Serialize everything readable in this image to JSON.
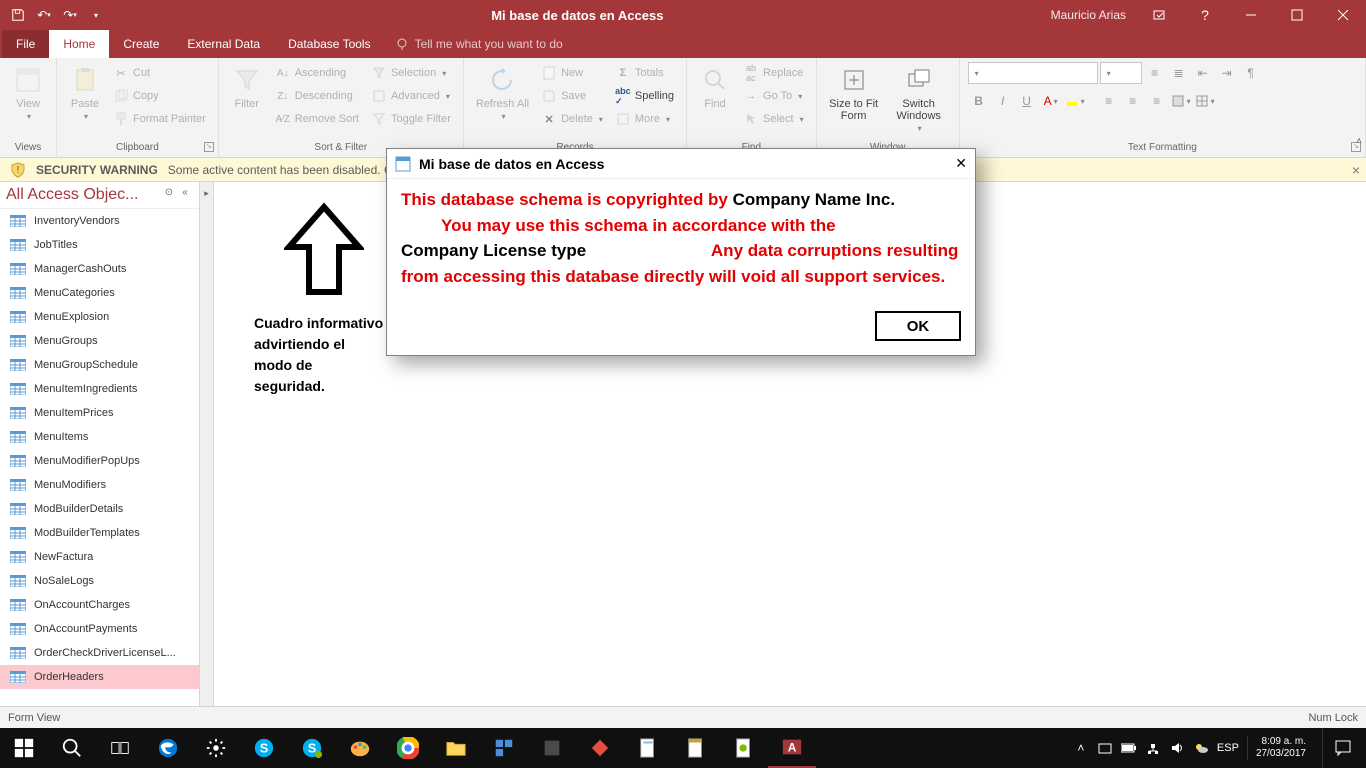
{
  "titlebar": {
    "title": "Mi base de datos en Access",
    "user": "Mauricio Arias"
  },
  "tabs": {
    "file": "File",
    "home": "Home",
    "create": "Create",
    "external": "External Data",
    "dbtools": "Database Tools",
    "tellme": "Tell me what you want to do"
  },
  "ribbon": {
    "views": {
      "label": "Views",
      "view": "View"
    },
    "clipboard": {
      "label": "Clipboard",
      "paste": "Paste",
      "cut": "Cut",
      "copy": "Copy",
      "fmtpainter": "Format Painter"
    },
    "sortfilter": {
      "label": "Sort & Filter",
      "filter": "Filter",
      "asc": "Ascending",
      "desc": "Descending",
      "remsort": "Remove Sort",
      "selection": "Selection",
      "advanced": "Advanced",
      "toggle": "Toggle Filter"
    },
    "records": {
      "label": "Records",
      "refresh": "Refresh All",
      "new": "New",
      "save": "Save",
      "delete": "Delete",
      "totals": "Totals",
      "spelling": "Spelling",
      "more": "More"
    },
    "find": {
      "label": "Find",
      "find": "Find",
      "replace": "Replace",
      "goto": "Go To",
      "select": "Select"
    },
    "window": {
      "label": "Window",
      "sizefit": "Size to Fit Form",
      "switch": "Switch Windows"
    },
    "textfmt": {
      "label": "Text Formatting"
    }
  },
  "security": {
    "warning": "SECURITY WARNING",
    "msg": "Some active content has been disabled. Cl"
  },
  "nav": {
    "title": "All Access Objec...",
    "items": [
      "InventoryVendors",
      "JobTitles",
      "ManagerCashOuts",
      "MenuCategories",
      "MenuExplosion",
      "MenuGroups",
      "MenuGroupSchedule",
      "MenuItemIngredients",
      "MenuItemPrices",
      "MenuItems",
      "MenuModifierPopUps",
      "MenuModifiers",
      "ModBuilderDetails",
      "ModBuilderTemplates",
      "NewFactura",
      "NoSaleLogs",
      "OnAccountCharges",
      "OnAccountPayments",
      "OrderCheckDriverLicenseL...",
      "OrderHeaders"
    ],
    "selected_index": 19
  },
  "canvas": {
    "info": "Cuadro informativo advirtiendo el modo de seguridad."
  },
  "dialog": {
    "title": "Mi base de datos en Access",
    "line1a": "This database schema is copyrighted by ",
    "line1b": "Company Name Inc.",
    "line2a": "You may use this schema in accordance with the",
    "line2b": "Company License type",
    "line3": "Any data corruptions resulting from accessing this database directly will void all support services.",
    "ok": "OK"
  },
  "status": {
    "left": "Form View",
    "right": "Num Lock"
  },
  "taskbar": {
    "lang": "ESP",
    "time": "8:09 a. m.",
    "date": "27/03/2017"
  }
}
